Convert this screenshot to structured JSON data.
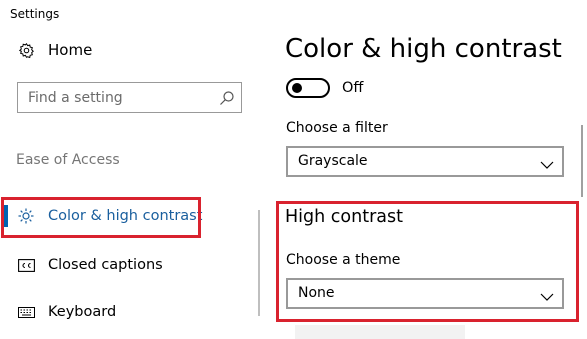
{
  "window": {
    "title": "Settings"
  },
  "sidebar": {
    "home": {
      "label": "Home",
      "icon": "gear-icon"
    },
    "search": {
      "placeholder": "Find a setting",
      "value": "",
      "icon": "search-icon"
    },
    "section_header": "Ease of Access",
    "items": [
      {
        "label": "Color & high contrast",
        "icon": "brightness-icon",
        "selected": true
      },
      {
        "label": "Closed captions",
        "icon": "closed-captions-icon",
        "selected": false
      },
      {
        "label": "Keyboard",
        "icon": "keyboard-icon",
        "selected": false
      }
    ]
  },
  "main": {
    "title": "Color & high contrast",
    "toggle": {
      "state_label": "Off",
      "on": false
    },
    "filter": {
      "label": "Choose a filter",
      "value": "Grayscale"
    },
    "high_contrast": {
      "title": "High contrast",
      "theme_label": "Choose a theme",
      "theme_value": "None"
    }
  },
  "colors": {
    "accent": "#0063b1",
    "selected_text": "#1a5f9e",
    "highlight_border": "#d9222e",
    "secondary_text": "#767676"
  }
}
